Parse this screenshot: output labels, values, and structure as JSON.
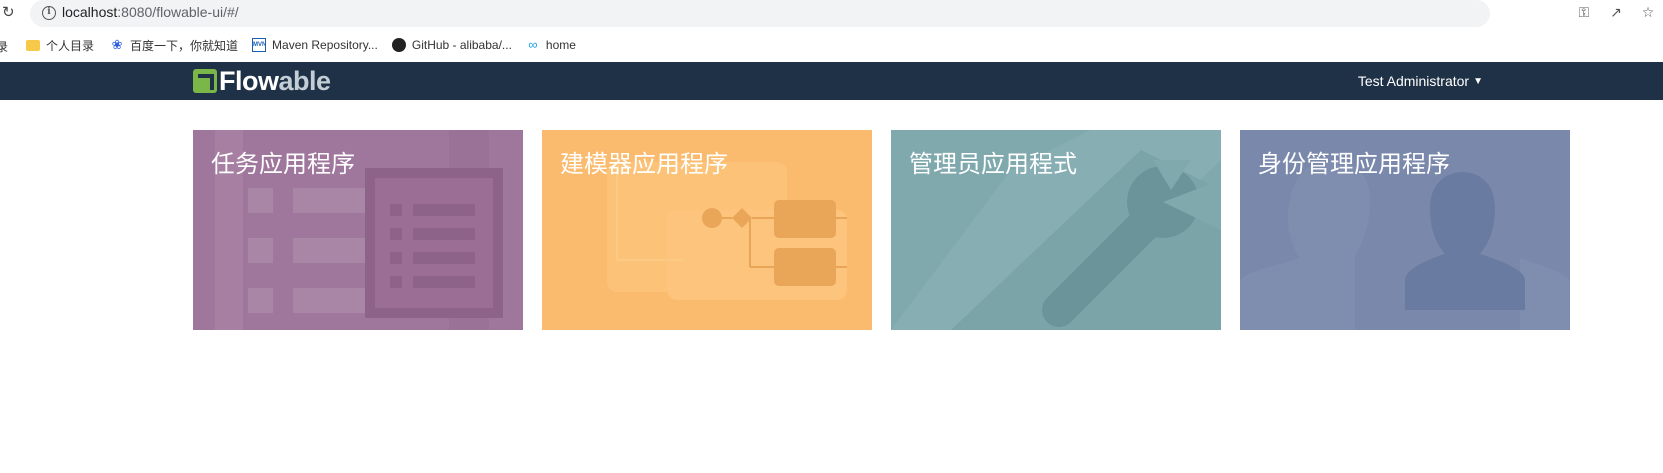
{
  "browser": {
    "url_host": "localhost",
    "url_path": ":8080/flowable-ui/#/",
    "bookmarks_cut_label": "录",
    "bookmarks": [
      {
        "label": "个人目录",
        "icon": "folder-icon"
      },
      {
        "label": "百度一下，你就知道",
        "icon": "baidu-icon"
      },
      {
        "label": "Maven Repository...",
        "icon": "maven-icon"
      },
      {
        "label": "GitHub - alibaba/...",
        "icon": "github-icon"
      },
      {
        "label": "home",
        "icon": "infinity-icon"
      }
    ]
  },
  "navbar": {
    "logo_flow": "Flow",
    "logo_able": "able",
    "user_label": "Test Administrator",
    "bg": "#1f3146"
  },
  "tiles": [
    {
      "title": "任务应用程序",
      "color": "#a0779c",
      "icon": "task-list-icon"
    },
    {
      "title": "建模器应用程序",
      "color": "#fbbb6e",
      "icon": "process-diagram-icon"
    },
    {
      "title": "管理员应用程式",
      "color": "#80a9ae",
      "icon": "wrench-icon"
    },
    {
      "title": "身份管理应用程序",
      "color": "#7a89ab",
      "icon": "user-silhouette-icon"
    }
  ]
}
